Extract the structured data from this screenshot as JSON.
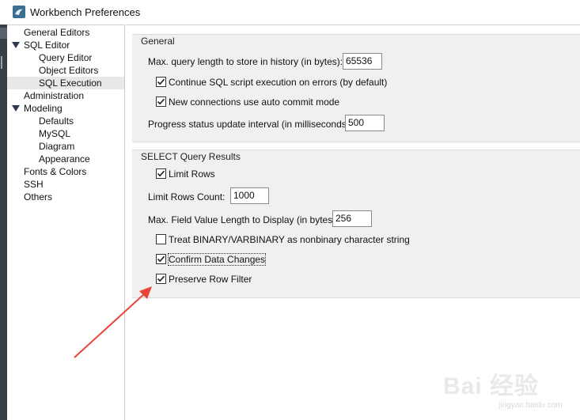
{
  "window": {
    "title": "Workbench Preferences"
  },
  "sidebar": {
    "items": [
      {
        "label": "General Editors",
        "level": 0,
        "expandable": false,
        "selected": false
      },
      {
        "label": "SQL Editor",
        "level": 0,
        "expandable": true,
        "selected": false
      },
      {
        "label": "Query Editor",
        "level": 1,
        "expandable": false,
        "selected": false
      },
      {
        "label": "Object Editors",
        "level": 1,
        "expandable": false,
        "selected": false
      },
      {
        "label": "SQL Execution",
        "level": 1,
        "expandable": false,
        "selected": true
      },
      {
        "label": "Administration",
        "level": 0,
        "expandable": false,
        "selected": false
      },
      {
        "label": "Modeling",
        "level": 0,
        "expandable": true,
        "selected": false
      },
      {
        "label": "Defaults",
        "level": 1,
        "expandable": false,
        "selected": false
      },
      {
        "label": "MySQL",
        "level": 1,
        "expandable": false,
        "selected": false
      },
      {
        "label": "Diagram",
        "level": 1,
        "expandable": false,
        "selected": false
      },
      {
        "label": "Appearance",
        "level": 1,
        "expandable": false,
        "selected": false
      },
      {
        "label": "Fonts & Colors",
        "level": 0,
        "expandable": false,
        "selected": false
      },
      {
        "label": "SSH",
        "level": 0,
        "expandable": false,
        "selected": false
      },
      {
        "label": "Others",
        "level": 0,
        "expandable": false,
        "selected": false
      }
    ]
  },
  "general": {
    "title": "General",
    "max_query_length": {
      "label": "Max. query length to store in history (in bytes):",
      "value": "65536"
    },
    "continue_on_errors": {
      "label": "Continue SQL script execution on errors (by default)",
      "checked": true
    },
    "auto_commit": {
      "label": "New connections use auto commit mode",
      "checked": true
    },
    "progress_interval": {
      "label": "Progress status update interval (in milliseconds):",
      "value": "500"
    }
  },
  "select_results": {
    "title": "SELECT Query Results",
    "limit_rows": {
      "label": "Limit Rows",
      "checked": true
    },
    "limit_rows_count": {
      "label": "Limit Rows Count:",
      "value": "1000"
    },
    "max_field_length": {
      "label": "Max. Field Value Length to Display (in bytes):",
      "value": "256"
    },
    "treat_binary": {
      "label": "Treat BINARY/VARBINARY as nonbinary character string",
      "checked": false
    },
    "confirm_changes": {
      "label": "Confirm Data Changes",
      "checked": true
    },
    "preserve_filter": {
      "label": "Preserve Row Filter",
      "checked": true
    }
  },
  "annotation": {
    "arrow_color": "#e8443a"
  },
  "watermark": {
    "main": "Bai 经验",
    "sub": "jingyan.baidu.com"
  }
}
